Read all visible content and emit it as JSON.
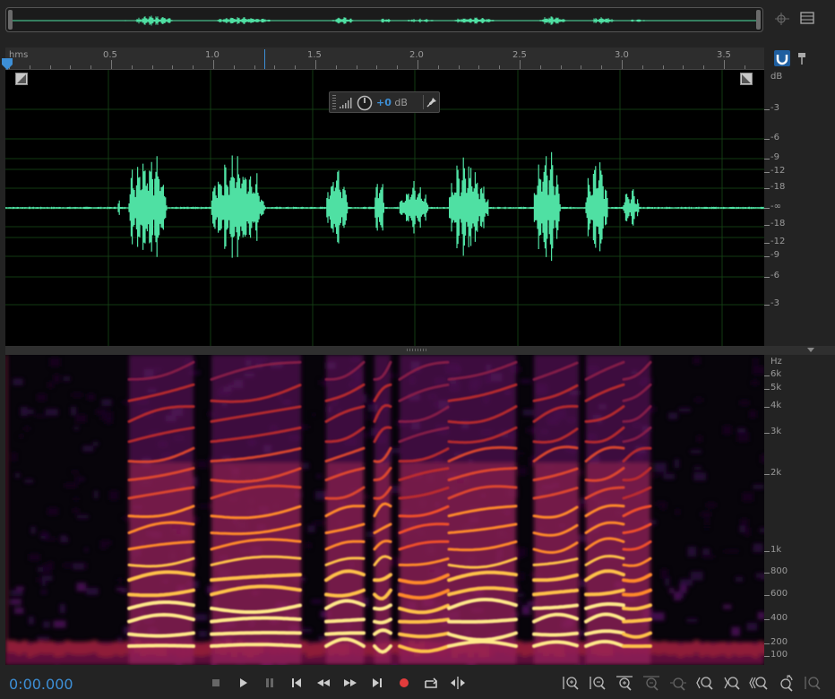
{
  "ruler": {
    "unit": "hms",
    "ticks": [
      "0.5",
      "1.0",
      "1.5",
      "2.0",
      "2.5",
      "3.0",
      "3.5"
    ]
  },
  "hud": {
    "gain_value": "+0",
    "gain_unit": "dB"
  },
  "db_scale": {
    "header": "dB",
    "labels": [
      "-3",
      "-6",
      "-9",
      "-12",
      "-18",
      "-∞",
      "-18",
      "-12",
      "-9",
      "-6",
      "-3"
    ]
  },
  "hz_scale": {
    "header": "Hz",
    "labels": [
      "6k",
      "5k",
      "4k",
      "3k",
      "2k",
      "1k",
      "800",
      "600",
      "400",
      "200",
      "100"
    ]
  },
  "transport": {
    "time": "0:00.000"
  },
  "colors": {
    "waveform": "#4fe0a3",
    "accent": "#3d8fd6",
    "record": "#e23c3c"
  },
  "icons": {
    "transport": [
      "stop-icon",
      "play-icon",
      "pause-icon",
      "move-to-start-icon",
      "rewind-icon",
      "fast-forward-icon",
      "move-to-end-icon",
      "record-icon",
      "loop-icon",
      "skip-icon"
    ],
    "zoom": [
      "zoom-in-amplitude-icon",
      "zoom-out-amplitude-icon",
      "zoom-in-time-icon",
      "zoom-out-time-icon",
      "zoom-selection-icon",
      "zoom-in-left-icon",
      "zoom-in-right-icon",
      "zoom-out-full-icon",
      "zoom-to-selection-icon",
      "zoom-in-frequency-icon"
    ]
  }
}
